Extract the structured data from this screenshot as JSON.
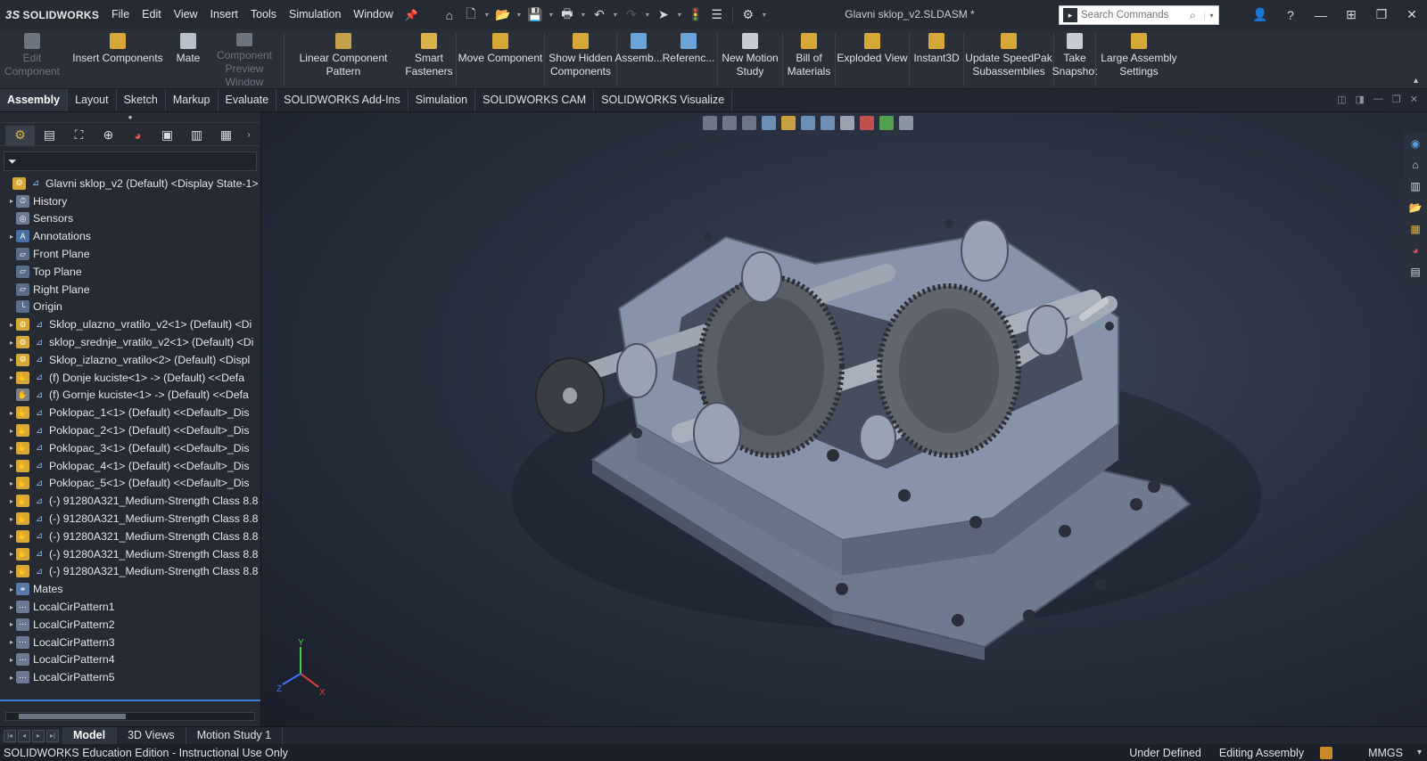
{
  "app": {
    "logo_text": "SOLIDWORKS",
    "logo_mark": "3S",
    "document_title": "Glavni sklop_v2.SLDASM *"
  },
  "menu": [
    "File",
    "Edit",
    "View",
    "Insert",
    "Tools",
    "Simulation",
    "Window"
  ],
  "search": {
    "placeholder": "Search Commands"
  },
  "ribbon": [
    {
      "label": "Edit\nComponent",
      "disabled": true,
      "color": "#6d7480"
    },
    {
      "label": "Insert Components",
      "disabled": false,
      "color": "#d6a838"
    },
    {
      "label": "Mate",
      "disabled": false,
      "color": "#b8c0cc"
    },
    {
      "label": "Component\nPreview Window",
      "disabled": true,
      "color": "#6d7480"
    },
    {
      "label": "Linear Component Pattern",
      "disabled": false,
      "color": "#c3a24a"
    },
    {
      "label": "Smart\nFasteners",
      "disabled": false,
      "color": "#d9b04a"
    },
    {
      "label": "Move Component",
      "disabled": false,
      "color": "#d6a838"
    },
    {
      "label": "Show Hidden\nComponents",
      "disabled": false,
      "color": "#d6a838"
    },
    {
      "label": "Assemb...",
      "disabled": false,
      "color": "#6aa4d8"
    },
    {
      "label": "Referenc...",
      "disabled": false,
      "color": "#6aa4d8"
    },
    {
      "label": "New Motion\nStudy",
      "disabled": false,
      "color": "#c8ccd2"
    },
    {
      "label": "Bill of\nMaterials",
      "disabled": false,
      "color": "#d6a838"
    },
    {
      "label": "Exploded View",
      "disabled": false,
      "color": "#d6a838"
    },
    {
      "label": "Instant3D",
      "disabled": false,
      "color": "#d6a838"
    },
    {
      "label": "Update SpeedPak\nSubassemblies",
      "disabled": false,
      "color": "#d6a838"
    },
    {
      "label": "Take\nSnapshot",
      "disabled": false,
      "color": "#c8ccd2"
    },
    {
      "label": "Large Assembly\nSettings",
      "disabled": false,
      "color": "#d6a838"
    }
  ],
  "tabs": [
    "Assembly",
    "Layout",
    "Sketch",
    "Markup",
    "Evaluate",
    "SOLIDWORKS Add-Ins",
    "Simulation",
    "SOLIDWORKS CAM",
    "SOLIDWORKS Visualize"
  ],
  "active_tab": "Assembly",
  "tree": [
    {
      "label": "Glavni sklop_v2 (Default) <Display State-1>",
      "indent": 0,
      "expand": "",
      "icon": "assembly"
    },
    {
      "label": "History",
      "indent": 1,
      "expand": "▸",
      "icon": "history"
    },
    {
      "label": "Sensors",
      "indent": 1,
      "expand": "",
      "icon": "sensor"
    },
    {
      "label": "Annotations",
      "indent": 1,
      "expand": "▸",
      "icon": "annotation"
    },
    {
      "label": "Front Plane",
      "indent": 1,
      "expand": "",
      "icon": "plane"
    },
    {
      "label": "Top Plane",
      "indent": 1,
      "expand": "",
      "icon": "plane"
    },
    {
      "label": "Right Plane",
      "indent": 1,
      "expand": "",
      "icon": "plane"
    },
    {
      "label": "Origin",
      "indent": 1,
      "expand": "",
      "icon": "origin"
    },
    {
      "label": "Sklop_ulazno_vratilo_v2<1> (Default) <Di",
      "indent": 1,
      "expand": "▸",
      "icon": "subassembly"
    },
    {
      "label": "sklop_srednje_vratilo_v2<1> (Default) <Di",
      "indent": 1,
      "expand": "▸",
      "icon": "subassembly"
    },
    {
      "label": "Sklop_izlazno_vratilo<2> (Default) <Displ",
      "indent": 1,
      "expand": "▸",
      "icon": "subassembly"
    },
    {
      "label": "(f) Donje kuciste<1> -> (Default) <<Defa",
      "indent": 1,
      "expand": "▸",
      "icon": "part"
    },
    {
      "label": "(f) Gornje kuciste<1> -> (Default) <<Defa",
      "indent": 1,
      "expand": "",
      "icon": "part-hidden"
    },
    {
      "label": "Poklopac_1<1> (Default) <<Default>_Dis",
      "indent": 1,
      "expand": "▸",
      "icon": "part"
    },
    {
      "label": "Poklopac_2<1> (Default) <<Default>_Dis",
      "indent": 1,
      "expand": "▸",
      "icon": "part"
    },
    {
      "label": "Poklopac_3<1> (Default) <<Default>_Dis",
      "indent": 1,
      "expand": "▸",
      "icon": "part"
    },
    {
      "label": "Poklopac_4<1> (Default) <<Default>_Dis",
      "indent": 1,
      "expand": "▸",
      "icon": "part"
    },
    {
      "label": "Poklopac_5<1> (Default) <<Default>_Dis",
      "indent": 1,
      "expand": "▸",
      "icon": "part"
    },
    {
      "label": "(-) 91280A321_Medium-Strength Class 8.8",
      "indent": 1,
      "expand": "▸",
      "icon": "part"
    },
    {
      "label": "(-) 91280A321_Medium-Strength Class 8.8",
      "indent": 1,
      "expand": "▸",
      "icon": "part"
    },
    {
      "label": "(-) 91280A321_Medium-Strength Class 8.8",
      "indent": 1,
      "expand": "▸",
      "icon": "part"
    },
    {
      "label": "(-) 91280A321_Medium-Strength Class 8.8",
      "indent": 1,
      "expand": "▸",
      "icon": "part"
    },
    {
      "label": "(-) 91280A321_Medium-Strength Class 8.8",
      "indent": 1,
      "expand": "▸",
      "icon": "part"
    },
    {
      "label": "Mates",
      "indent": 1,
      "expand": "▸",
      "icon": "mates"
    },
    {
      "label": "LocalCirPattern1",
      "indent": 1,
      "expand": "▸",
      "icon": "pattern"
    },
    {
      "label": "LocalCirPattern2",
      "indent": 1,
      "expand": "▸",
      "icon": "pattern"
    },
    {
      "label": "LocalCirPattern3",
      "indent": 1,
      "expand": "▸",
      "icon": "pattern"
    },
    {
      "label": "LocalCirPattern4",
      "indent": 1,
      "expand": "▸",
      "icon": "pattern"
    },
    {
      "label": "LocalCirPattern5",
      "indent": 1,
      "expand": "▸",
      "icon": "pattern"
    }
  ],
  "bottom_tabs": [
    "Model",
    "3D Views",
    "Motion Study 1"
  ],
  "active_bottom_tab": "Model",
  "status": {
    "left": "SOLIDWORKS Education Edition - Instructional Use Only",
    "state": "Under Defined",
    "mode": "Editing Assembly",
    "units": "MMGS"
  },
  "triad": {
    "x": "X",
    "y": "Y",
    "z": "Z"
  },
  "colors": {
    "accent": "#3a7fd5",
    "housing": "#8c97aa",
    "gear": "#5a5e66"
  }
}
